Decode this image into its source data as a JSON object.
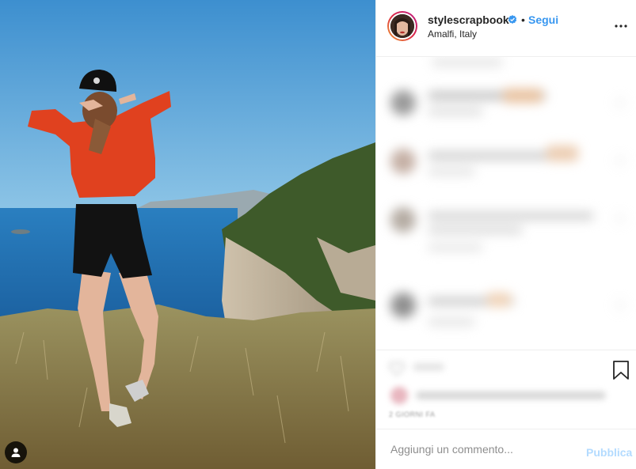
{
  "post": {
    "username": "stylescrapbook",
    "location": "Amalfi, Italy",
    "follow_label": "Segui",
    "separator": "•",
    "date": "2 GIORNI FA"
  },
  "comment_box": {
    "placeholder": "Aggiungi un commento...",
    "publish_label": "Pubblica"
  },
  "colors": {
    "accent": "#3897f0",
    "publish_disabled": "#b3dbff",
    "sky": "#4aa0d8",
    "sea": "#1f74b8",
    "sweater": "#e0411f"
  },
  "icons": {
    "verified": "verified-badge-icon",
    "more": "more-options-icon",
    "bookmark": "bookmark-icon",
    "tag": "user-tag-icon"
  }
}
